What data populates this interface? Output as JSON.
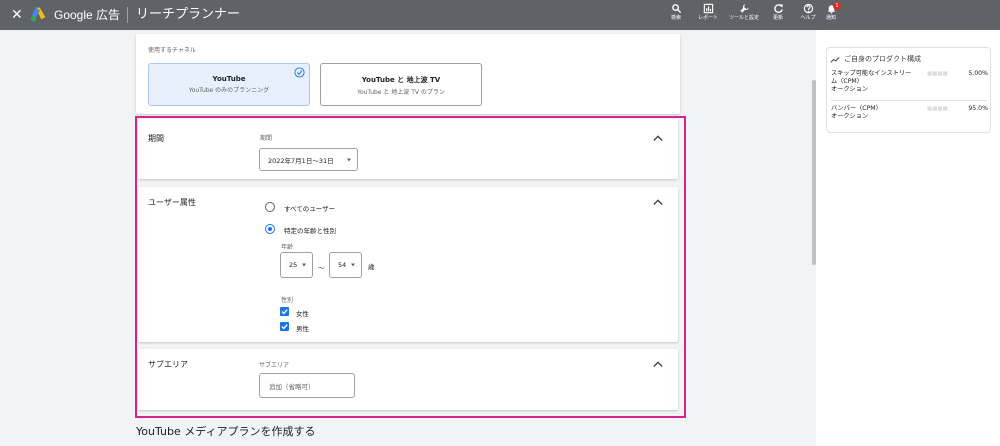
{
  "header": {
    "close_symbol": "✕",
    "brand": "Google 広告",
    "app_title": "リーチプランナー",
    "buttons": [
      {
        "label": "検索",
        "icon": "search-icon"
      },
      {
        "label": "レポート",
        "icon": "reports-icon"
      },
      {
        "label": "ツールと設定",
        "icon": "tools-icon"
      },
      {
        "label": "更新",
        "icon": "refresh-icon"
      },
      {
        "label": "ヘルプ",
        "icon": "help-icon"
      },
      {
        "label": "通知",
        "icon": "bell-icon",
        "badge": "1"
      }
    ]
  },
  "channels": {
    "label": "使用するチャネル",
    "options": [
      {
        "title": "YouTube",
        "subtitle": "YouTube のみのプランニング",
        "selected": true
      },
      {
        "title": "YouTube と 地上波 TV",
        "subtitle": "YouTube と 地上波 TV のプラン",
        "selected": false
      }
    ]
  },
  "period": {
    "section_label": "期間",
    "field_label": "期間",
    "value": "2022年7月1日～31日"
  },
  "demographics": {
    "section_label": "ユーザー属性",
    "all_users": "すべてのユーザー",
    "specific": "特定の年齢と性別",
    "age_label": "年齢",
    "age_from": "25",
    "age_sep": "～",
    "age_to": "54",
    "age_unit": "歳",
    "gender_label": "性別",
    "female": "女性",
    "male": "男性"
  },
  "subarea": {
    "section_label": "サブエリア",
    "field_label": "サブエリア",
    "placeholder": "追加（省略可）"
  },
  "bottom_title": "YouTube メディアプランを作成する",
  "side_panel": {
    "title": "ご自身のプロダクト構成",
    "rows": [
      {
        "line1": "スキップ可能なインストリー",
        "line2": "ム（CPM）",
        "line3": "オークション",
        "blurred": "■■■■",
        "percent": "5.00%"
      },
      {
        "line1": "バンパー（CPM）",
        "line2": "オークション",
        "line3": "",
        "blurred": "■■■■",
        "percent": "95.0%"
      }
    ]
  },
  "colors": {
    "topbar": "#5f6368",
    "accent": "#1a73e8",
    "highlight": "#d6248e",
    "selected_bg": "#e8f0fe"
  }
}
